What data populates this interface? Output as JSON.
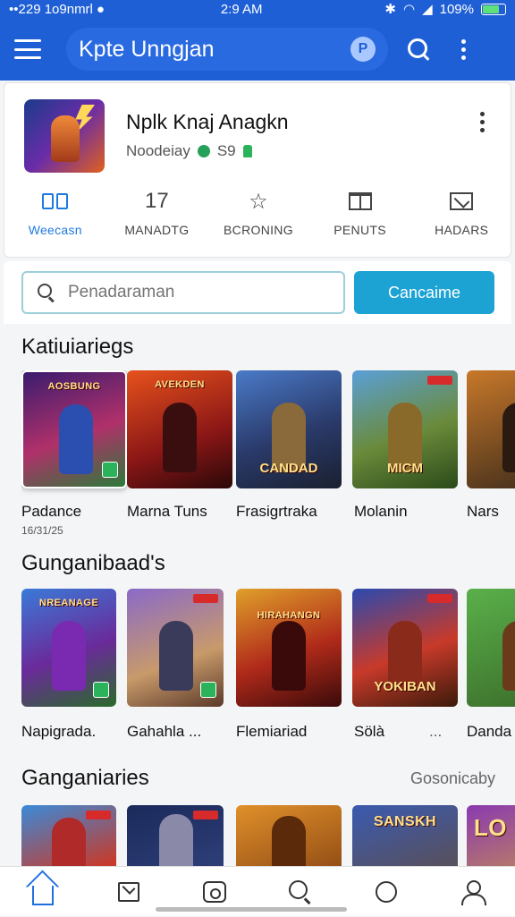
{
  "status": {
    "left": "••229 1o9nmrl",
    "time": "2:9 AM",
    "battery": "109%"
  },
  "app_bar": {
    "title": "Kpte Unngjan",
    "badge": "P"
  },
  "app_card": {
    "title": "Nplk Knaj Anagkn",
    "subtitle": "Noodeiay",
    "rating": "S9"
  },
  "tabs": [
    {
      "label": "Weecasn",
      "icon": "grid-icon"
    },
    {
      "label": "MANADTG",
      "icon": "number-icon",
      "icon_text": "17"
    },
    {
      "label": "BCRONING",
      "icon": "star-icon"
    },
    {
      "label": "PENUTS",
      "icon": "book-icon"
    },
    {
      "label": "HADARS",
      "icon": "mail-icon"
    }
  ],
  "search": {
    "placeholder": "Penadaraman",
    "button_label": "Cancaime"
  },
  "sections": [
    {
      "title": "Katiuiariegs",
      "items": [
        {
          "label": "Padance",
          "sub": "16/31/25",
          "banner": "AOSBUNG"
        },
        {
          "label": "Marna Tuns",
          "banner": "AVEKDEN"
        },
        {
          "label": "Frasigrtraka",
          "banner": "CANDAD"
        },
        {
          "label": "Molanin",
          "banner": "MICM"
        },
        {
          "label": "Nars",
          "banner": ""
        }
      ]
    },
    {
      "title": "Gunganibaad's",
      "items": [
        {
          "label": "Napigrada.",
          "banner": "NREANAGE"
        },
        {
          "label": "Gahahla ...",
          "banner": ""
        },
        {
          "label": "Flemiariad",
          "banner": "HIRAHANGN"
        },
        {
          "label": "Sölà",
          "banner": "YOKIBAN"
        },
        {
          "label": "Danda",
          "banner": ""
        }
      ]
    },
    {
      "title": "Ganganiaries",
      "link": "Gosonicaby",
      "items": [
        {
          "banner": ""
        },
        {
          "banner": ""
        },
        {
          "banner": ""
        },
        {
          "banner": "SANSKH"
        },
        {
          "banner": "LO"
        }
      ]
    }
  ],
  "more_dots": "...",
  "colors": {
    "primary": "#1f5fd6",
    "accent": "#1ca3d4",
    "active_tab": "#1f7ae0"
  },
  "bottom_nav": [
    {
      "icon": "home-icon"
    },
    {
      "icon": "inbox-icon"
    },
    {
      "icon": "games-icon"
    },
    {
      "icon": "search-icon"
    },
    {
      "icon": "chat-icon"
    },
    {
      "icon": "profile-icon"
    }
  ]
}
